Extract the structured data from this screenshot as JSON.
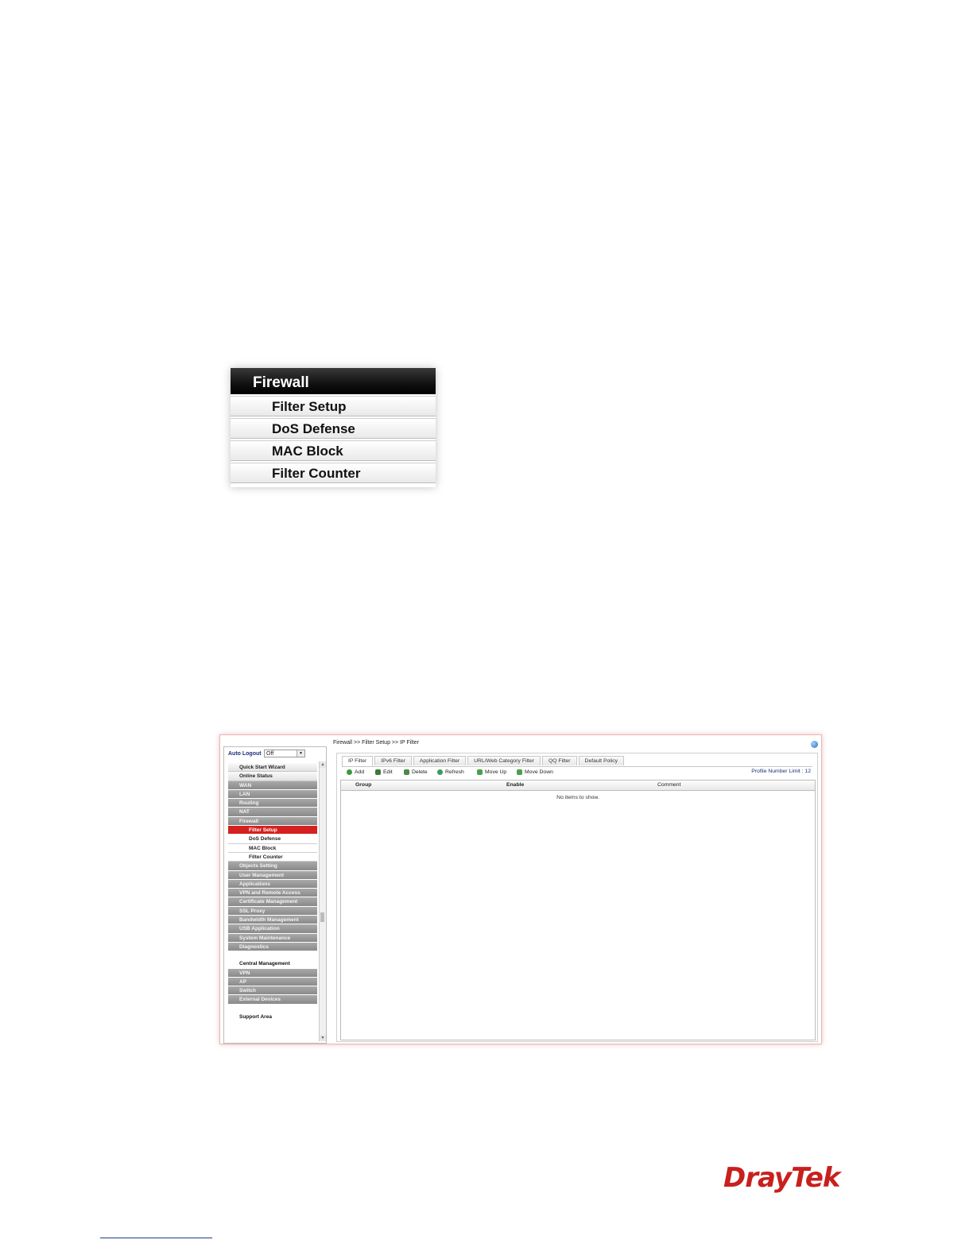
{
  "firewall_menu": {
    "header": "Firewall",
    "items": [
      "Filter Setup",
      "DoS Defense",
      "MAC Block",
      "Filter Counter"
    ]
  },
  "router_ui": {
    "auto_logout_label": "Auto Logout",
    "auto_logout_value": "Off",
    "sidebar": [
      {
        "label": "Quick Start Wizard",
        "style": "light"
      },
      {
        "label": "Online Status",
        "style": "light"
      },
      {
        "label": "WAN",
        "style": "dark"
      },
      {
        "label": "LAN",
        "style": "dark"
      },
      {
        "label": "Routing",
        "style": "dark"
      },
      {
        "label": "NAT",
        "style": "dark"
      },
      {
        "label": "Firewall",
        "style": "dark"
      },
      {
        "label": "Filter Setup",
        "style": "active"
      },
      {
        "label": "DoS Defense",
        "style": "sub"
      },
      {
        "label": "MAC Block",
        "style": "sub"
      },
      {
        "label": "Filter Counter",
        "style": "sub"
      },
      {
        "label": "Objects Setting",
        "style": "dark"
      },
      {
        "label": "User Management",
        "style": "dark"
      },
      {
        "label": "Applications",
        "style": "dark"
      },
      {
        "label": "VPN and Remote Access",
        "style": "dark"
      },
      {
        "label": "Certificate Management",
        "style": "dark"
      },
      {
        "label": "SSL Proxy",
        "style": "dark"
      },
      {
        "label": "Bandwidth Management",
        "style": "dark"
      },
      {
        "label": "USB Application",
        "style": "dark"
      },
      {
        "label": "System Maintenance",
        "style": "dark"
      },
      {
        "label": "Diagnostics",
        "style": "dark"
      },
      {
        "label": "",
        "style": "blank"
      },
      {
        "label": "Central Management",
        "style": "section"
      },
      {
        "label": "VPN",
        "style": "dark"
      },
      {
        "label": "AP",
        "style": "dark"
      },
      {
        "label": "Switch",
        "style": "dark"
      },
      {
        "label": "External Devices",
        "style": "dark"
      },
      {
        "label": "",
        "style": "blank"
      },
      {
        "label": "Support Area",
        "style": "section"
      }
    ],
    "breadcrumb": "Firewall >> Filter Setup >> IP Filter",
    "tabs": [
      "IP Filter",
      "IPv6 Filter",
      "Application Filter",
      "URL/Web Category Filter",
      "QQ Filter",
      "Default Policy"
    ],
    "toolbar": {
      "add": "Add",
      "edit": "Edit",
      "delete": "Delete",
      "refresh": "Refresh",
      "move_up": "Move Up",
      "move_down": "Move Down",
      "profile_limit": "Profile Number Limit : 12"
    },
    "columns": [
      "Group",
      "Enable",
      "Comment"
    ],
    "empty_text": "No items to show.",
    "colors": {
      "active_menu": "#d42020",
      "dark_menu": "#999999"
    }
  },
  "logo": {
    "part1": "Dray",
    "part2": "Tek"
  }
}
